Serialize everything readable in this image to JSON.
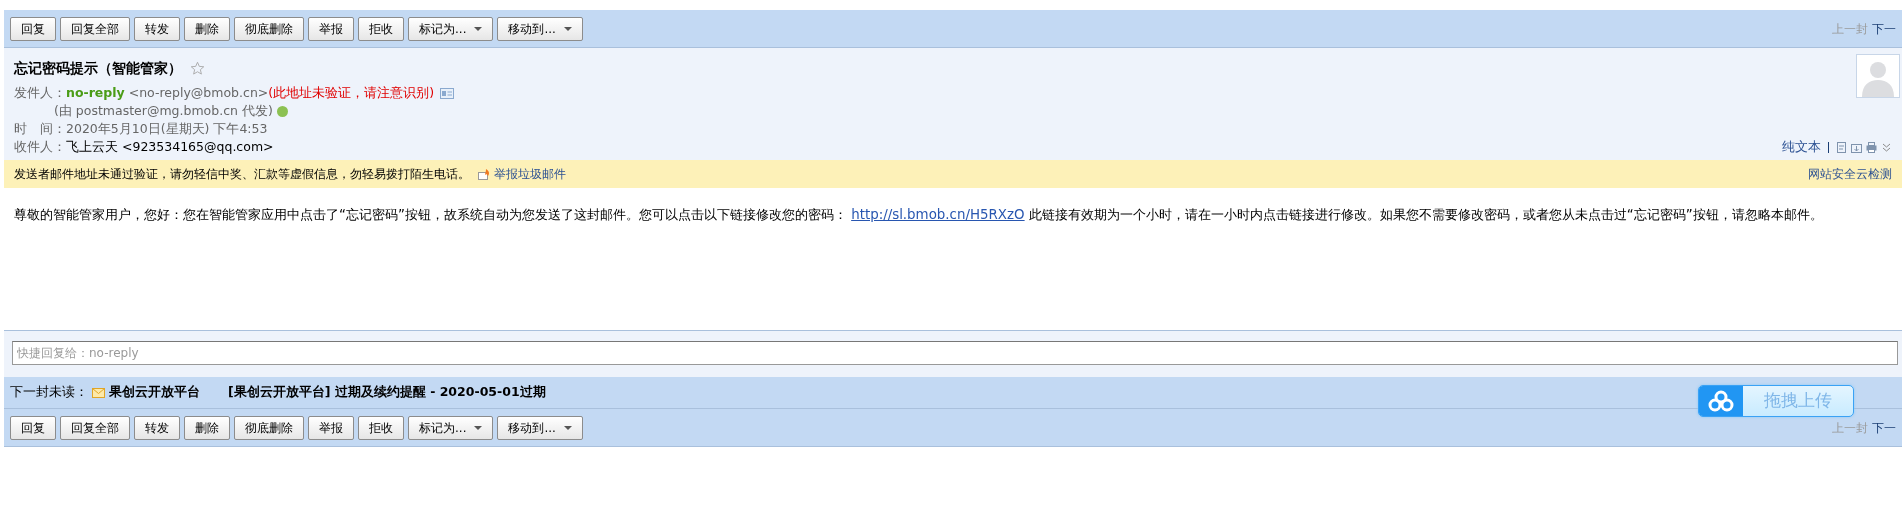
{
  "toolbar_top": {
    "buttons": [
      {
        "label": "回复",
        "kind": "plain"
      },
      {
        "label": "回复全部",
        "kind": "plain"
      },
      {
        "label": "转发",
        "kind": "plain"
      },
      {
        "label": "删除",
        "kind": "plain"
      },
      {
        "label": "彻底删除",
        "kind": "plain"
      },
      {
        "label": "举报",
        "kind": "plain"
      },
      {
        "label": "拒收",
        "kind": "plain"
      },
      {
        "label": "标记为...",
        "kind": "dropdown"
      },
      {
        "label": "移动到...",
        "kind": "dropdown"
      }
    ],
    "prev": "上一封",
    "next": "下一"
  },
  "header": {
    "subject": "忘记密码提示（智能管家）",
    "starred": false,
    "from_label": "发件人：",
    "sender_name": "no-reply",
    "sender_address": "<no-reply@bmob.cn>",
    "sender_warning": "(此地址未验证，请注意识别)",
    "proxy": "(由 postmaster@mg.bmob.cn 代发)",
    "time_label": "时　间：",
    "time": "2020年5月10日(星期天) 下午4:53",
    "to_label": "收件人：",
    "to_name": "飞上云天",
    "to_address": "<923534165@qq.com>",
    "plain_text_link": "纯文本"
  },
  "warning_bar": {
    "text": "发送者邮件地址未通过验证，请勿轻信中奖、汇款等虚假信息，勿轻易拨打陌生电话。",
    "report_link": "举报垃圾邮件",
    "cloud_check_link": "网站安全云检测"
  },
  "body": {
    "before_link": "尊敬的智能管家用户，您好：您在智能管家应用中点击了“忘记密码”按钮，故系统自动为您发送了这封邮件。您可以点击以下链接修改您的密码：",
    "link": "http://sl.bmob.cn/H5RXzO",
    "after_link": "此链接有效期为一个小时，请在一小时内点击链接进行修改。如果您不需要修改密码，或者您从未点击过“忘记密码”按钮，请忽略本邮件。"
  },
  "quick_reply": {
    "placeholder": "快捷回复给：no-reply"
  },
  "next_unread": {
    "label": "下一封未读：",
    "sender": "果创云开放平台",
    "subject": "[果创云开放平台] 过期及续约提醒 - 2020-05-01过期"
  },
  "upload_widget": {
    "label": "拖拽上传"
  },
  "toolbar_bottom": {
    "buttons": [
      {
        "label": "回复",
        "kind": "plain"
      },
      {
        "label": "回复全部",
        "kind": "plain"
      },
      {
        "label": "转发",
        "kind": "plain"
      },
      {
        "label": "删除",
        "kind": "plain"
      },
      {
        "label": "彻底删除",
        "kind": "plain"
      },
      {
        "label": "举报",
        "kind": "plain"
      },
      {
        "label": "拒收",
        "kind": "plain"
      },
      {
        "label": "标记为...",
        "kind": "dropdown"
      },
      {
        "label": "移动到...",
        "kind": "dropdown"
      }
    ],
    "prev": "上一封",
    "next": "下一"
  }
}
